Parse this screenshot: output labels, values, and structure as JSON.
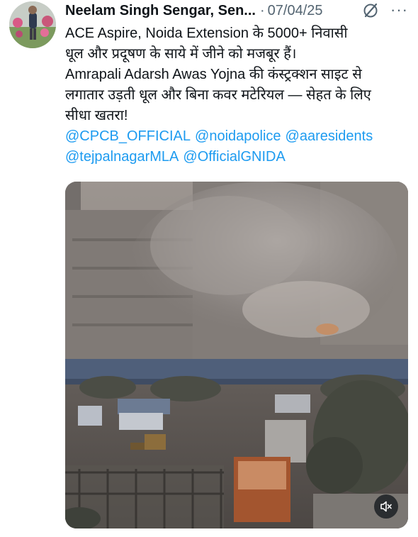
{
  "tweet": {
    "author_name": "Neelam Singh Sengar, Sen...",
    "separator": "·",
    "date": "07/04/25",
    "more_label": "···",
    "lines": [
      "ACE Aspire, Noida Extension के 5000+ निवासी",
      "धूल और प्रदूषण के साये में जीने को मजबूर हैं।",
      "Amrapali Adarsh Awas Yojna की कंस्ट्रक्शन साइट से",
      "लगातार उड़ती धूल और बिना कवर मटेरियल — सेहत के लिए",
      "सीधा खतरा!"
    ],
    "mentions_line1": [
      "@CPCB_OFFICIAL",
      "@noidapolice",
      "@aaresidents"
    ],
    "mentions_line2": [
      "@tejpalnagarMLA",
      "@OfficialGNIDA"
    ]
  },
  "icons": {
    "grok": "grok-icon",
    "mute": "mute-icon",
    "more": "more-icon"
  },
  "colors": {
    "link": "#1d9bf0",
    "secondary_text": "#536471",
    "primary_text": "#0f1419"
  }
}
